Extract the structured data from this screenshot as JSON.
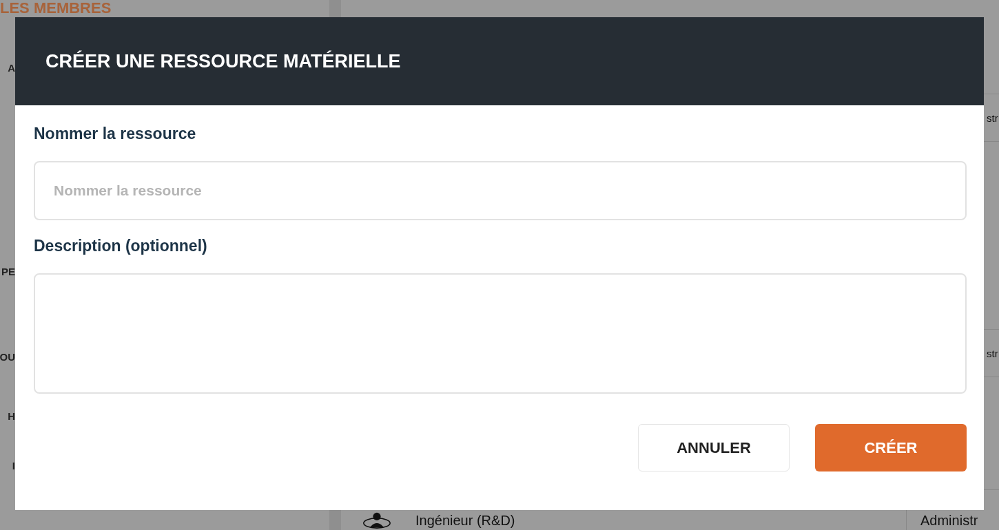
{
  "background": {
    "section_title": "LES MEMBRES",
    "sidebar_fragments": [
      "A",
      "PE",
      "OU",
      "H",
      "I"
    ],
    "table_fragments": [
      "str",
      "str"
    ],
    "last_row": {
      "role": "Ingénieur (R&D)",
      "column_2": "Administr"
    }
  },
  "dialog": {
    "title": "CRÉER UNE RESSOURCE MATÉRIELLE",
    "fields": [
      {
        "label": "Nommer la ressource",
        "placeholder": "Nommer la ressource",
        "kind": "input"
      },
      {
        "label": "Description (optionnel)",
        "kind": "textarea"
      }
    ],
    "buttons": [
      {
        "label": "ANNULER",
        "kind": "secondary"
      },
      {
        "label": "CRÉER",
        "kind": "primary"
      }
    ]
  }
}
